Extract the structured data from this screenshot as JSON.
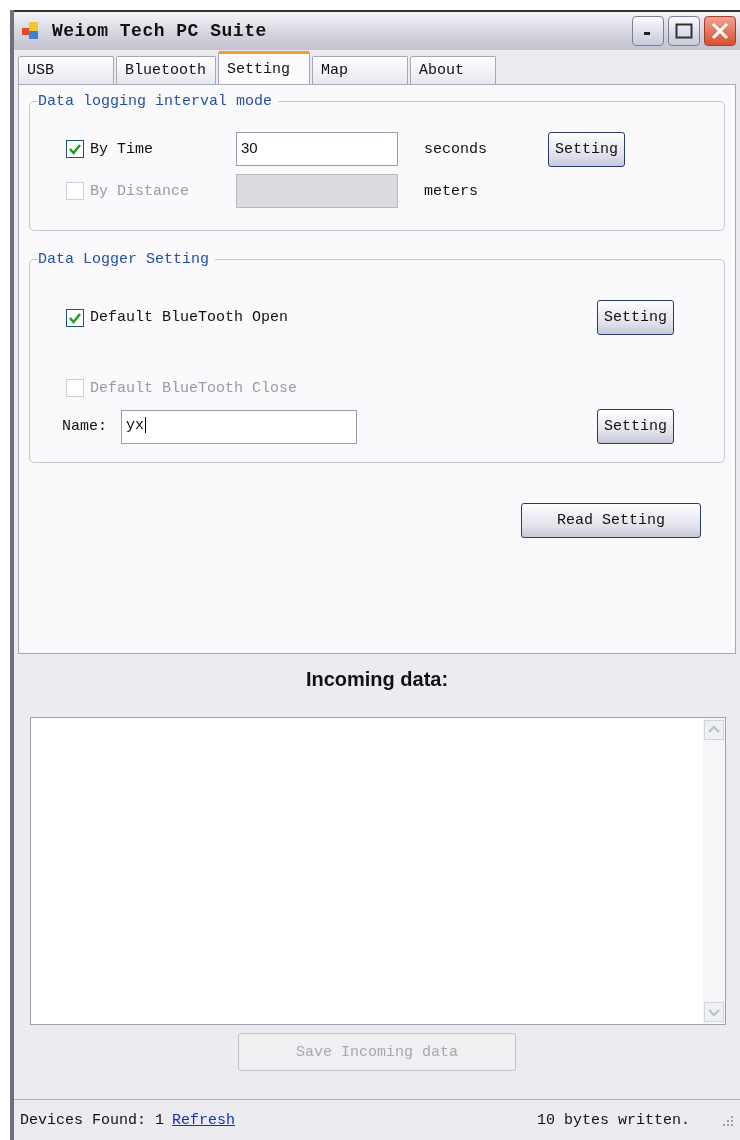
{
  "window": {
    "title": "Weiom Tech PC Suite"
  },
  "tabs": [
    {
      "label": "USB",
      "selected": false
    },
    {
      "label": "Bluetooth",
      "selected": false
    },
    {
      "label": "Setting",
      "selected": true
    },
    {
      "label": "Map",
      "selected": false
    },
    {
      "label": "About",
      "selected": false
    }
  ],
  "interval_mode": {
    "title": "Data logging interval mode",
    "options": [
      {
        "label": "By Time",
        "checked": true,
        "disabled": false,
        "value": "30",
        "unit": "seconds"
      },
      {
        "label": "By Distance",
        "checked": false,
        "disabled": true,
        "unit": "meters"
      }
    ],
    "button": "Setting"
  },
  "logger": {
    "title": "Data Logger Setting",
    "options": [
      {
        "label": "Default BlueTooth Open",
        "checked": true,
        "disabled": false
      },
      {
        "label": "Default BlueTooth Close",
        "checked": false,
        "disabled": true
      }
    ],
    "name_label": "Name:",
    "name_value": "yx",
    "buttons": [
      "Setting",
      "Setting"
    ]
  },
  "read_button": "Read Setting",
  "incoming": {
    "title": "Incoming data:"
  },
  "save_button": {
    "label": "Save Incoming data",
    "disabled": true
  },
  "status_bar": {
    "devices": "Devices Found: 1",
    "link": "Refresh",
    "message": "10 bytes written."
  }
}
